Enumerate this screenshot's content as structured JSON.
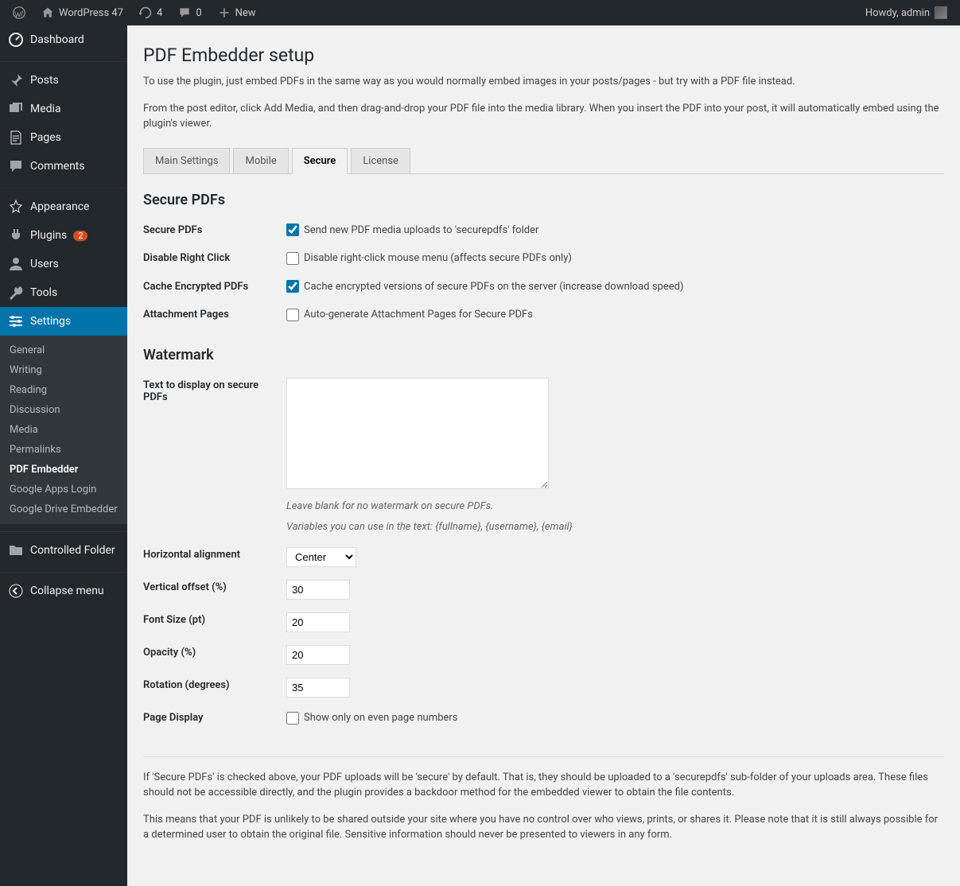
{
  "adminbar": {
    "site_name": "WordPress 47",
    "updates": "4",
    "comments": "0",
    "new_label": "New",
    "howdy": "Howdy, admin"
  },
  "sidebar": {
    "dashboard": "Dashboard",
    "posts": "Posts",
    "media": "Media",
    "pages": "Pages",
    "comments": "Comments",
    "appearance": "Appearance",
    "plugins": "Plugins",
    "plugins_badge": "2",
    "users": "Users",
    "tools": "Tools",
    "settings": "Settings",
    "submenu": {
      "general": "General",
      "writing": "Writing",
      "reading": "Reading",
      "discussion": "Discussion",
      "media": "Media",
      "permalinks": "Permalinks",
      "pdf_embedder": "PDF Embedder",
      "google_apps": "Google Apps Login",
      "google_drive": "Google Drive Embedder"
    },
    "controlled_folder": "Controlled Folder",
    "collapse": "Collapse menu"
  },
  "page": {
    "title": "PDF Embedder setup",
    "intro1": "To use the plugin, just embed PDFs in the same way as you would normally embed images in your posts/pages - but try with a PDF file instead.",
    "intro2": "From the post editor, click Add Media, and then drag-and-drop your PDF file into the media library. When you insert the PDF into your post, it will automatically embed using the plugin's viewer."
  },
  "tabs": {
    "main": "Main Settings",
    "mobile": "Mobile",
    "secure": "Secure",
    "license": "License"
  },
  "secure_section": {
    "heading": "Secure PDFs",
    "secure_pdfs_label": "Secure PDFs",
    "secure_pdfs_text": "Send new PDF media uploads to 'securepdfs' folder",
    "disable_rc_label": "Disable Right Click",
    "disable_rc_text": "Disable right-click mouse menu (affects secure PDFs only)",
    "cache_label": "Cache Encrypted PDFs",
    "cache_text": "Cache encrypted versions of secure PDFs on the server (increase download speed)",
    "attach_label": "Attachment Pages",
    "attach_text": "Auto-generate Attachment Pages for Secure PDFs"
  },
  "watermark": {
    "heading": "Watermark",
    "text_label": "Text to display on secure PDFs",
    "text_value": "",
    "hint1": "Leave blank for no watermark on secure PDFs.",
    "hint2": "Variables you can use in the text: {fullname}, {username}, {email}",
    "halign_label": "Horizontal alignment",
    "halign_value": "Center",
    "voffset_label": "Vertical offset (%)",
    "voffset_value": "30",
    "fontsize_label": "Font Size (pt)",
    "fontsize_value": "20",
    "opacity_label": "Opacity (%)",
    "opacity_value": "20",
    "rotation_label": "Rotation (degrees)",
    "rotation_value": "35",
    "pagedisplay_label": "Page Display",
    "pagedisplay_text": "Show only on even page numbers"
  },
  "footer": {
    "p1": "If 'Secure PDFs' is checked above, your PDF uploads will be 'secure' by default. That is, they should be uploaded to a 'securepdfs' sub-folder of your uploads area. These files should not be accessible directly, and the plugin provides a backdoor method for the embedded viewer to obtain the file contents.",
    "p2": "This means that your PDF is unlikely to be shared outside your site where you have no control over who views, prints, or shares it. Please note that it is still always possible for a determined user to obtain the original file. Sensitive information should never be presented to viewers in any form."
  }
}
